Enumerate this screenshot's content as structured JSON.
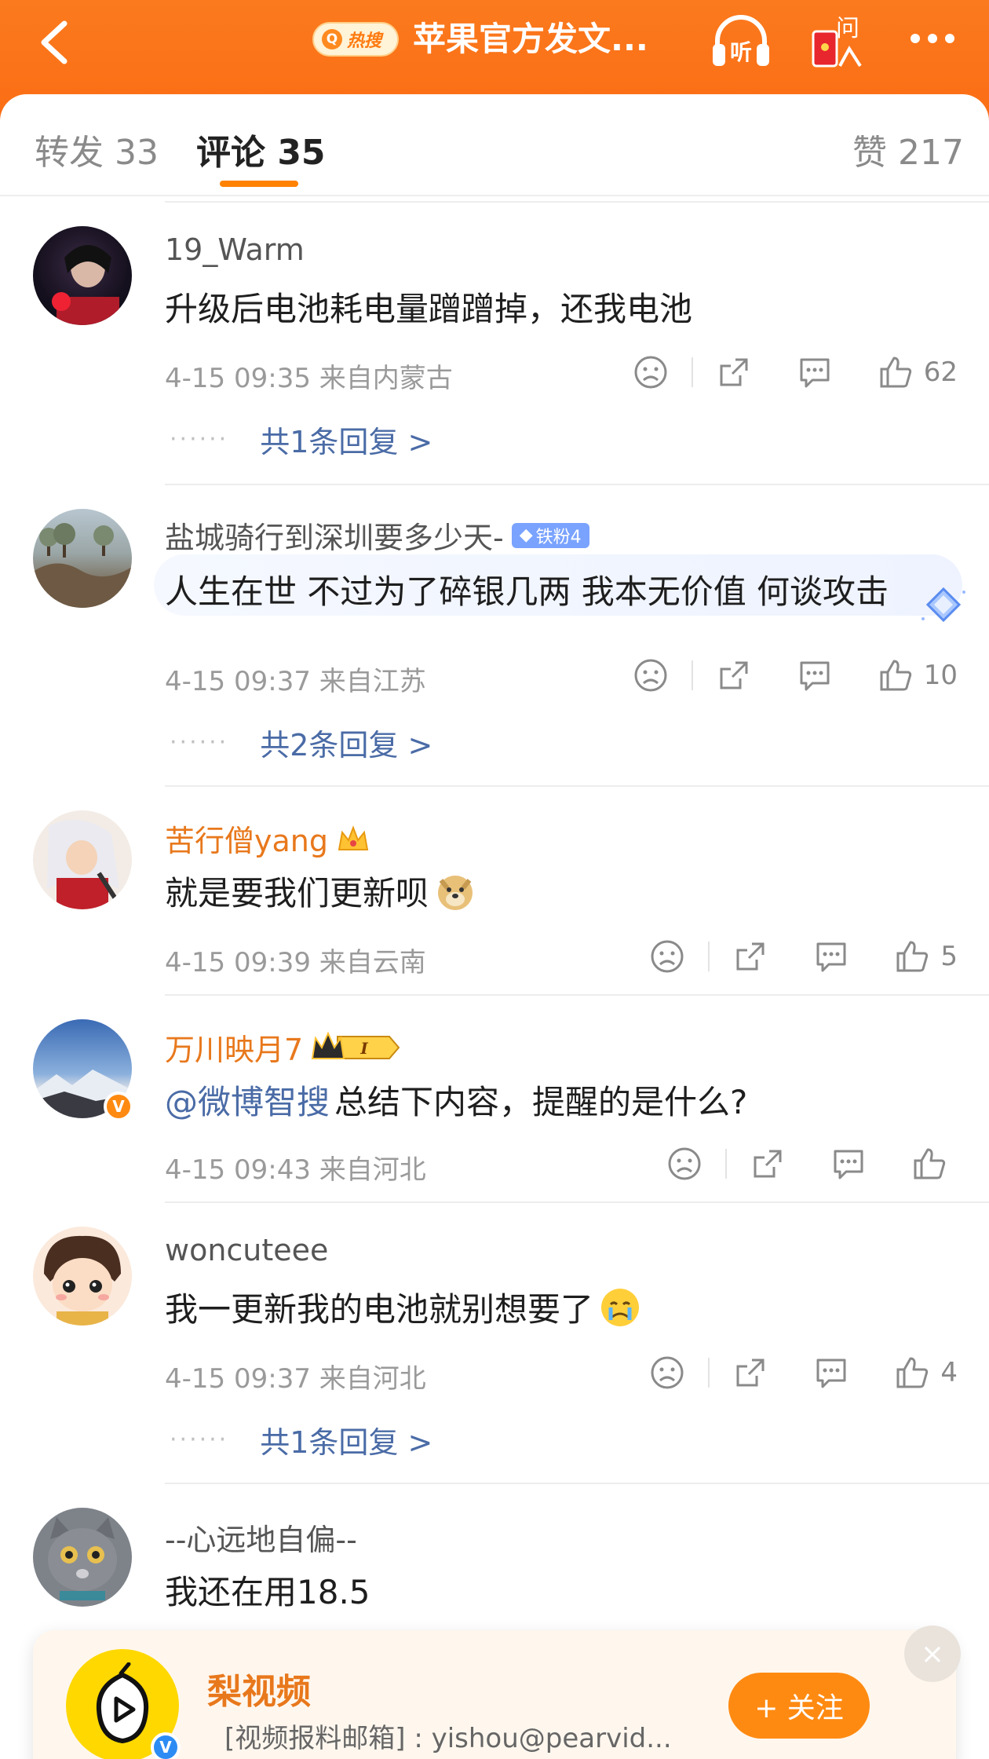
{
  "header": {
    "hot_badge": "热搜",
    "title": "苹果官方发文...",
    "listen_label": "听",
    "ask_label": "问"
  },
  "tabs": {
    "repost": "转发 33",
    "comments": "评论 35",
    "likes": "赞 217"
  },
  "comments": [
    {
      "username": "19_Warm",
      "text": "升级后电池耗电量蹭蹭掉，还我电池",
      "time_location": "4-15 09:35  来自内蒙古",
      "likes": "62",
      "replies": "共1条回复 >"
    },
    {
      "username": "盐城骑行到深圳要多少天-",
      "fan_badge": "铁粉4",
      "text": "人生在世 不过为了碎银几两 我本无价值 何谈攻击",
      "time_location": "4-15 09:37  来自江苏",
      "likes": "10",
      "replies": "共2条回复 >"
    },
    {
      "username": "苦行僧yang",
      "text": "就是要我们更新呗",
      "time_location": "4-15 09:39  来自云南",
      "likes": "5"
    },
    {
      "username": "万川映月7",
      "member_level": "I",
      "mention": "@微博智搜",
      "text": " 总结下内容，提醒的是什么?",
      "time_location": "4-15 09:43  来自河北",
      "likes": ""
    },
    {
      "username": "woncuteee",
      "text": "我一更新我的电池就别想要了",
      "time_location": "4-15 09:37  来自河北",
      "likes": "4",
      "replies": "共1条回复 >"
    },
    {
      "username": "--心远地自偏--",
      "text": "我还在用18.5"
    }
  ],
  "ad": {
    "name": "梨视频",
    "desc": "[视频报料邮箱]  :  yishou@pearvid...",
    "follow_label": "+ 关注",
    "close_label": "×"
  },
  "colors": {
    "header_orange": "#fb7a1e",
    "accent": "#ff8200",
    "link_blue": "#4a6ba6",
    "vip_orange": "#e8781c"
  }
}
